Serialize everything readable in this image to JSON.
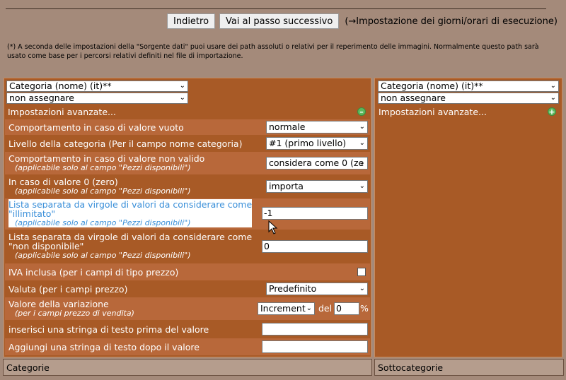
{
  "toolbar": {
    "back_label": "Indietro",
    "next_label": "Vai al passo successivo",
    "next_note": "(→Impostazione dei giorni/orari di esecuzione)"
  },
  "note": "(*) A seconda delle impostazioni della \"Sorgente dati\" puoi usare dei path assoluti o relativi per il reperimento delle immagini. Normalmente questo path sarà usato come base per i percorsi relativi definiti nel file di importazione.",
  "left": {
    "field_select": "Categoria (nome) (it)**",
    "assign_select": "non assegnare",
    "advanced_label": "Impostazioni avanzate...",
    "rows": {
      "empty_behavior": {
        "label": "Comportamento in caso di valore vuoto",
        "value": "normale"
      },
      "category_level": {
        "label": "Livello della categoria (Per il campo nome categoria)",
        "value": "#1 (primo livello)"
      },
      "invalid_behavior": {
        "label": "Comportamento in caso di valore non valido",
        "sub": "(applicabile solo al campo \"Pezzi disponibili\")",
        "value": "considera come 0 (ze"
      },
      "zero_value": {
        "label": "In caso di valore 0 (zero)",
        "sub": "(applicabile solo al campo \"Pezzi disponibili\")",
        "value": "importa"
      },
      "unlimited_list": {
        "label_line1": "Lista separata da virgole di valori da considerare come",
        "label_line2": "\"illimitato\"",
        "sub": "(applicabile solo al campo \"Pezzi disponibili\")",
        "value": "-1"
      },
      "unavailable_list": {
        "label_line1": "Lista separata da virgole di valori da considerare come",
        "label_line2": "\"non disponibile\"",
        "sub": "(applicabile solo al campo \"Pezzi disponibili\")",
        "value": "0"
      },
      "vat_included": {
        "label": "IVA inclusa (per i campi di tipo prezzo)",
        "checked": false
      },
      "currency": {
        "label": "Valuta (per i campi prezzo)",
        "value": "Predefinito"
      },
      "variation": {
        "label": "Valore della variazione",
        "sub": "(per i campi prezzo di vendita)",
        "mode": "Increment",
        "of_label": "del",
        "amount": "0",
        "unit": "%"
      },
      "prefix_text": {
        "label": "inserisci una stringa di testo prima del valore",
        "value": ""
      },
      "suffix_text": {
        "label": "Aggiungi una stringa di testo dopo il valore",
        "value": ""
      }
    }
  },
  "right": {
    "field_select": "Categoria (nome) (it)**",
    "assign_select": "non assegnare",
    "advanced_label": "Impostazioni avanzate..."
  },
  "bottom": {
    "left_label": "Categorie",
    "right_label": "Sottocategorie"
  },
  "colors": {
    "page_bg": "#a48a7a",
    "panel_bg": "#a85a26",
    "row_alt_bg": "#b8683a",
    "highlight_text": "#3a8fd9",
    "icon_green": "#5cb85c"
  },
  "icons": {
    "collapse": "minus-circle-icon",
    "expand": "plus-circle-icon",
    "dropdown": "chevron-down-icon",
    "pointer": "mouse-cursor-icon"
  }
}
